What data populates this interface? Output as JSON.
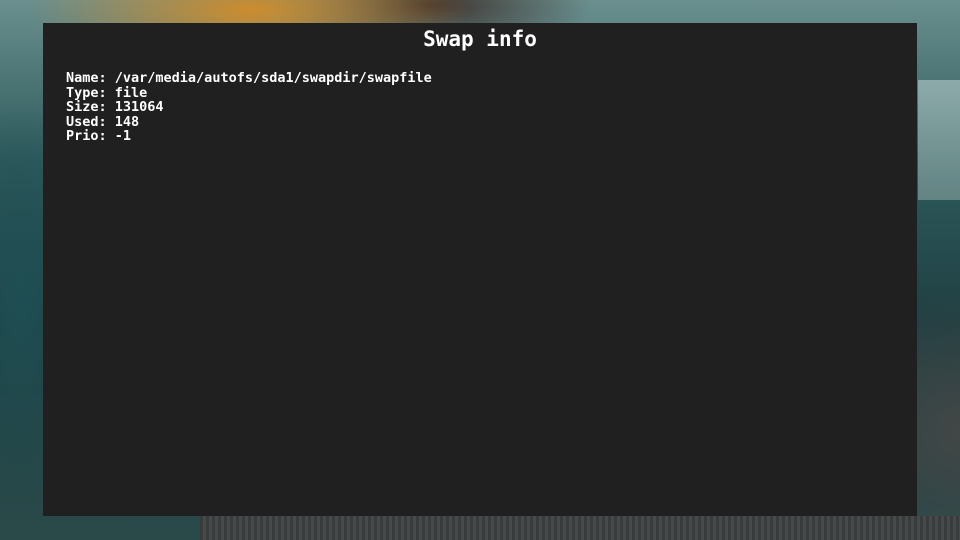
{
  "dialog": {
    "title": "Swap info",
    "rows": [
      {
        "label": "Name:",
        "value": "/var/media/autofs/sda1/swapdir/swapfile"
      },
      {
        "label": "Type:",
        "value": "file"
      },
      {
        "label": "Size:",
        "value": "131064"
      },
      {
        "label": "Used:",
        "value": "148"
      },
      {
        "label": "Prio:",
        "value": "-1"
      }
    ]
  },
  "colors": {
    "panel_background": "#202020",
    "text": "#ffffff"
  }
}
